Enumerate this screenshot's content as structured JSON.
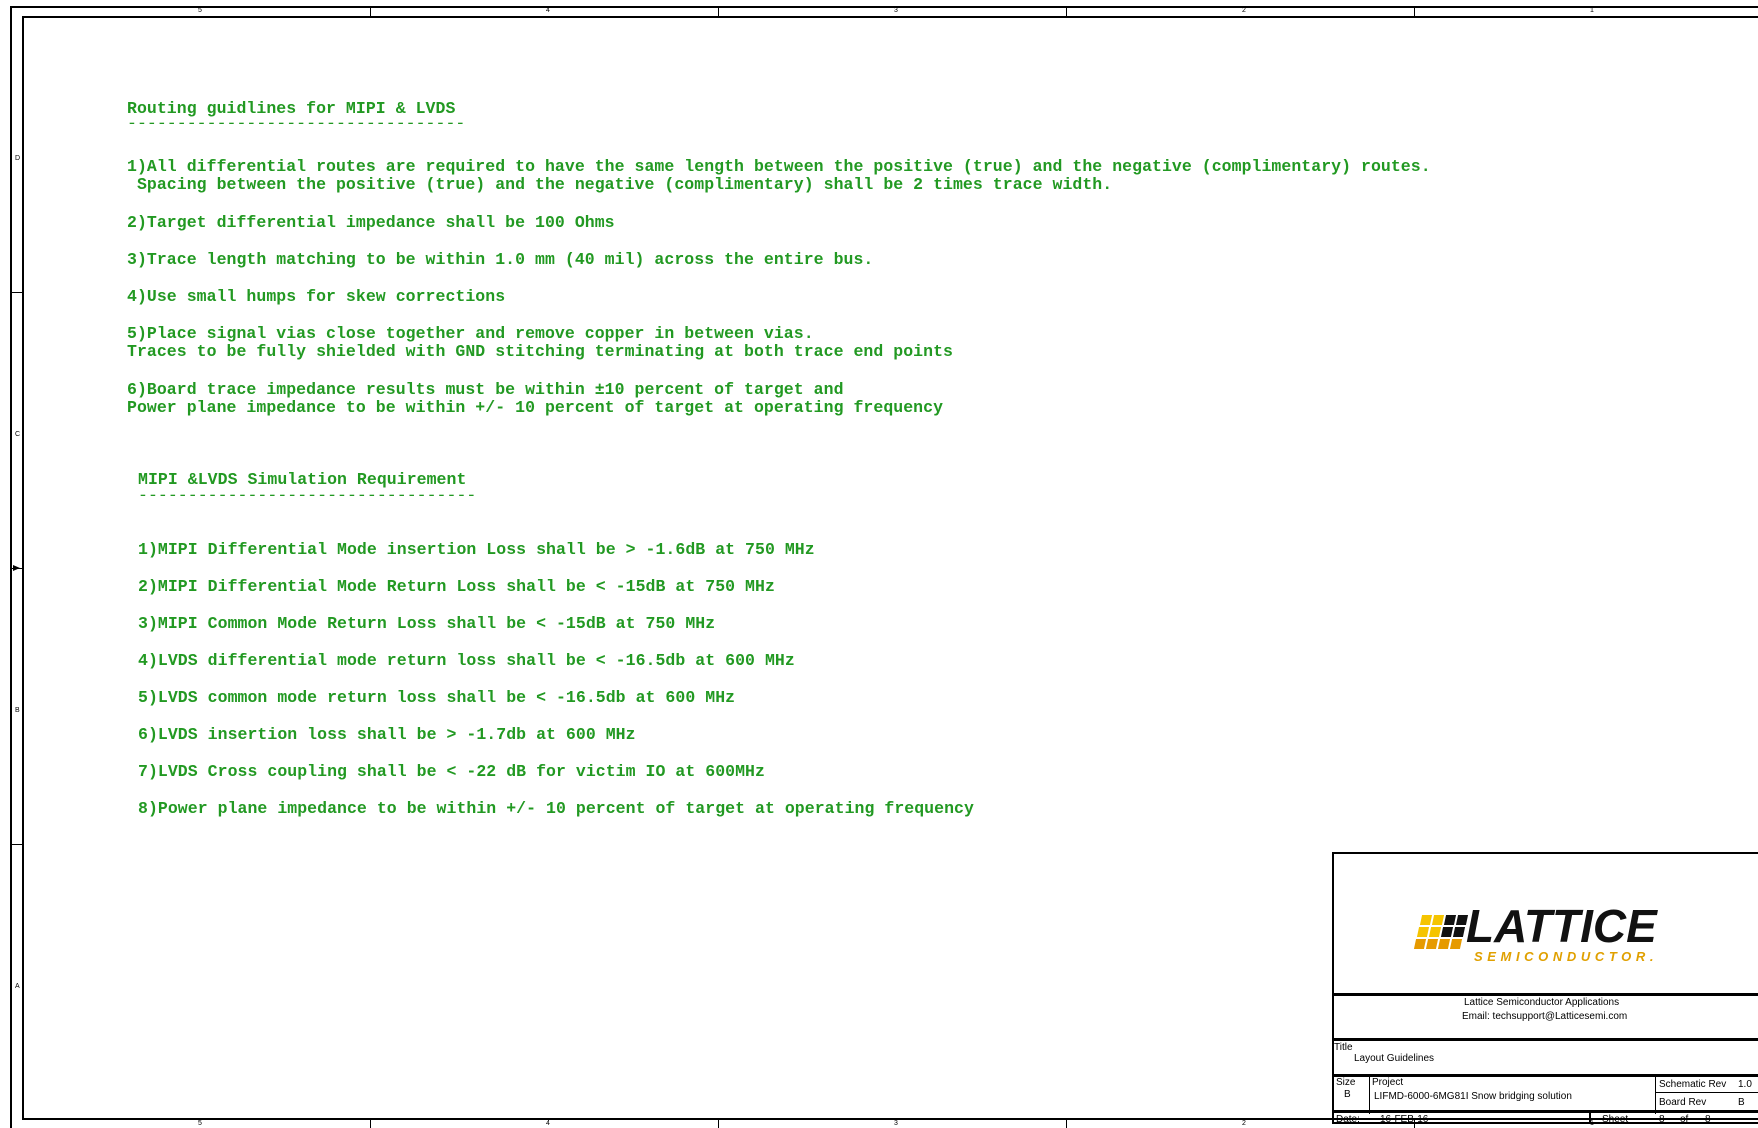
{
  "border": {
    "column_labels": [
      "5",
      "4",
      "3",
      "2",
      "1"
    ],
    "row_labels": [
      "D",
      "C",
      "B",
      "A"
    ]
  },
  "routing": {
    "heading": "Routing guidlines for MIPI & LVDS",
    "underline": "----------------------------------",
    "items": [
      "1)All differential routes are required to have the same length between the positive (true) and the negative (complimentary) routes.",
      " Spacing between the positive (true) and the negative (complimentary) shall be 2 times trace width.",
      "2)Target differential impedance shall be 100 Ohms",
      "3)Trace length matching to be within 1.0 mm (40 mil) across the entire bus.",
      "4)Use small humps for skew corrections",
      "5)Place signal vias close together and remove copper in between vias.",
      "Traces to be fully shielded with GND stitching terminating at both trace end points",
      "6)Board trace impedance results must be within ±10 percent of target and",
      "Power plane impedance to be within +/- 10 percent of target at operating frequency"
    ]
  },
  "simulation": {
    "heading": "MIPI &LVDS Simulation Requirement",
    "underline": "----------------------------------",
    "items": [
      "1)MIPI Differential Mode insertion Loss shall be > -1.6dB at 750 MHz",
      "2)MIPI Differential Mode Return Loss shall be < -15dB at 750 MHz",
      "3)MIPI Common Mode Return Loss shall be < -15dB at 750 MHz",
      "4)LVDS differential mode return loss shall be < -16.5db at 600 MHz",
      "5)LVDS common mode return loss shall be < -16.5db at 600 MHz",
      "6)LVDS insertion loss shall be > -1.7db at 600 MHz",
      "7)LVDS Cross coupling shall be < -22 dB for victim IO at 600MHz",
      "8)Power plane impedance to be within +/- 10 percent of target at operating frequency"
    ]
  },
  "title_block": {
    "logo_word": "LATTICE",
    "logo_sub": "SEMICONDUCTOR.",
    "logo_colors": {
      "yellow": "#f5c400",
      "orange": "#e69a00",
      "dark": "#111111"
    },
    "company": "Lattice Semiconductor Applications",
    "email": "Email: techsupport@Latticesemi.com",
    "title_label": "Title",
    "title_value": "Layout Guidelines",
    "size_label": "Size",
    "size_value": "B",
    "project_label": "Project",
    "project_value": "LIFMD-6000-6MG81I Snow bridging solution",
    "schematic_rev_label": "Schematic Rev",
    "schematic_rev_value": "1.0",
    "board_rev_label": "Board Rev",
    "board_rev_value": "B",
    "date_label": "Date:",
    "date_value": "16-FEB-16",
    "sheet_label": "Sheet",
    "sheet_value": "8",
    "of_label": "of",
    "of_value": "8"
  },
  "text_color": "#229922"
}
